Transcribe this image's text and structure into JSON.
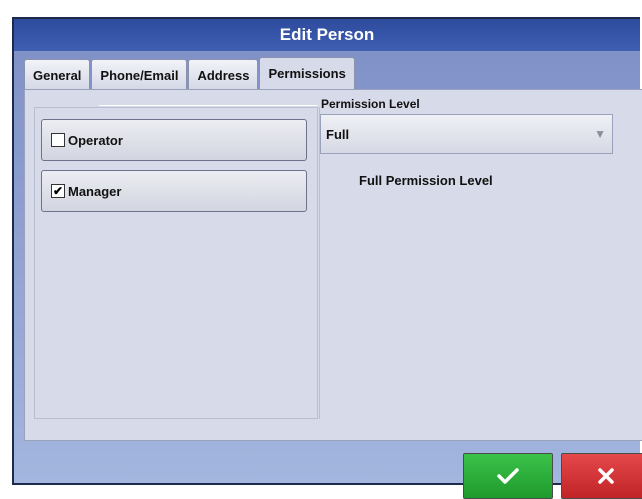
{
  "window": {
    "title": "Edit Person"
  },
  "tabs": [
    {
      "label": "General",
      "active": false
    },
    {
      "label": "Phone/Email",
      "active": false
    },
    {
      "label": "Address",
      "active": false
    },
    {
      "label": "Permissions",
      "active": true
    }
  ],
  "roles": [
    {
      "label": "Operator",
      "checked": false,
      "mark": ""
    },
    {
      "label": "Manager",
      "checked": true,
      "mark": "✔"
    }
  ],
  "permission": {
    "title": "Permission Level",
    "selected": "Full",
    "description": "Full Permission Level"
  },
  "actions": {
    "ok_icon": "checkmark-icon",
    "cancel_icon": "x-icon",
    "ok_color": "#2aae38",
    "cancel_color": "#d63335"
  }
}
